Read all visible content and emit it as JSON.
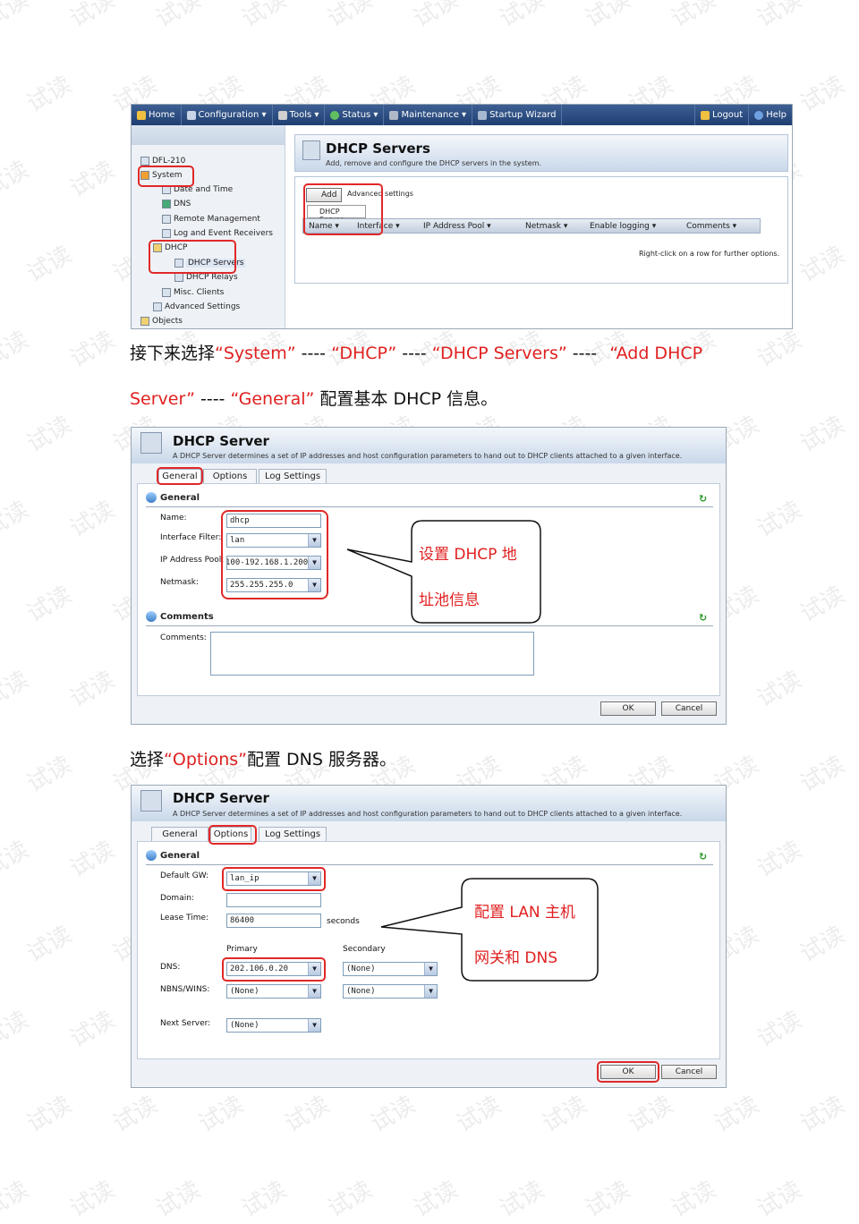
{
  "watermark": "试读",
  "shot1": {
    "toolbar": [
      "Home",
      "Configuration ▾",
      "Tools ▾",
      "Status ▾",
      "Maintenance ▾",
      "Startup Wizard"
    ],
    "toolbar_right": [
      "Logout",
      "Help"
    ],
    "tree": {
      "root": "DFL-210",
      "system": "System",
      "date_time": "Date and Time",
      "dns": "DNS",
      "remote": "Remote Management",
      "log": "Log and Event Receivers",
      "dhcp": "DHCP",
      "dhcp_servers": "DHCP Servers",
      "dhcp_relays": "DHCP Relays",
      "misc": "Misc. Clients",
      "advanced": "Advanced Settings",
      "objects": "Objects"
    },
    "panel_title": "DHCP Servers",
    "panel_sub": "Add, remove and configure the DHCP servers in the system.",
    "add_label": "Add ▾",
    "advanced_label": "Advanced settings",
    "dhcp_server_menu": "DHCP Server",
    "columns": [
      "Name ▾",
      "Interface ▾",
      "IP Address Pool ▾",
      "Netmask ▾",
      "Enable logging ▾",
      "Comments ▾"
    ],
    "hint": "Right-click on a row for further options."
  },
  "para1": {
    "a": "接下来选择",
    "system": "“System”",
    "dash1": " ---- ",
    "dhcp": "“DHCP”",
    "dash2": " ---- ",
    "servers": "“DHCP Servers”",
    "dash3": " ---- ",
    "add": "“Add DHCP",
    "server": "Server”",
    "dash4": " ---- ",
    "general": "“General”",
    "b": "  配置基本 DHCP 信息。"
  },
  "shot2": {
    "title": "DHCP Server",
    "sub": "A DHCP Server determines a set of IP addresses and host configuration parameters to hand out to DHCP clients attached to a given interface.",
    "tabs": [
      "General",
      "Options",
      "Log Settings"
    ],
    "section_general": "General",
    "name_label": "Name:",
    "name_value": "dhcp",
    "iface_label": "Interface Filter:",
    "iface_value": "lan",
    "pool_label": "IP Address Pool:",
    "pool_value": "100-192.168.1.200",
    "netmask_label": "Netmask:",
    "netmask_value": "255.255.255.0",
    "section_comments": "Comments",
    "comments_label": "Comments:",
    "ok": "OK",
    "cancel": "Cancel",
    "callout_l1": "设置 DHCP 地",
    "callout_l2": "址池信息"
  },
  "para2": {
    "a": "选择",
    "options": "“Options”",
    "b": "配置 DNS 服务器。"
  },
  "shot3": {
    "title": "DHCP Server",
    "sub": "A DHCP Server determines a set of IP addresses and host configuration parameters to hand out to DHCP clients attached to a given interface.",
    "tabs": [
      "General",
      "Options",
      "Log Settings"
    ],
    "section_general": "General",
    "gw_label": "Default GW:",
    "gw_value": "lan_ip",
    "domain_label": "Domain:",
    "lease_label": "Lease Time:",
    "lease_value": "86400",
    "lease_unit": "seconds",
    "primary": "Primary",
    "secondary": "Secondary",
    "dns_label": "DNS:",
    "dns_primary": "202.106.0.20",
    "dns_secondary": "(None)",
    "nbns_label": "NBNS/WINS:",
    "nbns_primary": "(None)",
    "nbns_secondary": "(None)",
    "next_label": "Next Server:",
    "next_value": "(None)",
    "ok": "OK",
    "cancel": "Cancel",
    "callout_l1": "配置 LAN 主机",
    "callout_l2": "网关和 DNS"
  }
}
